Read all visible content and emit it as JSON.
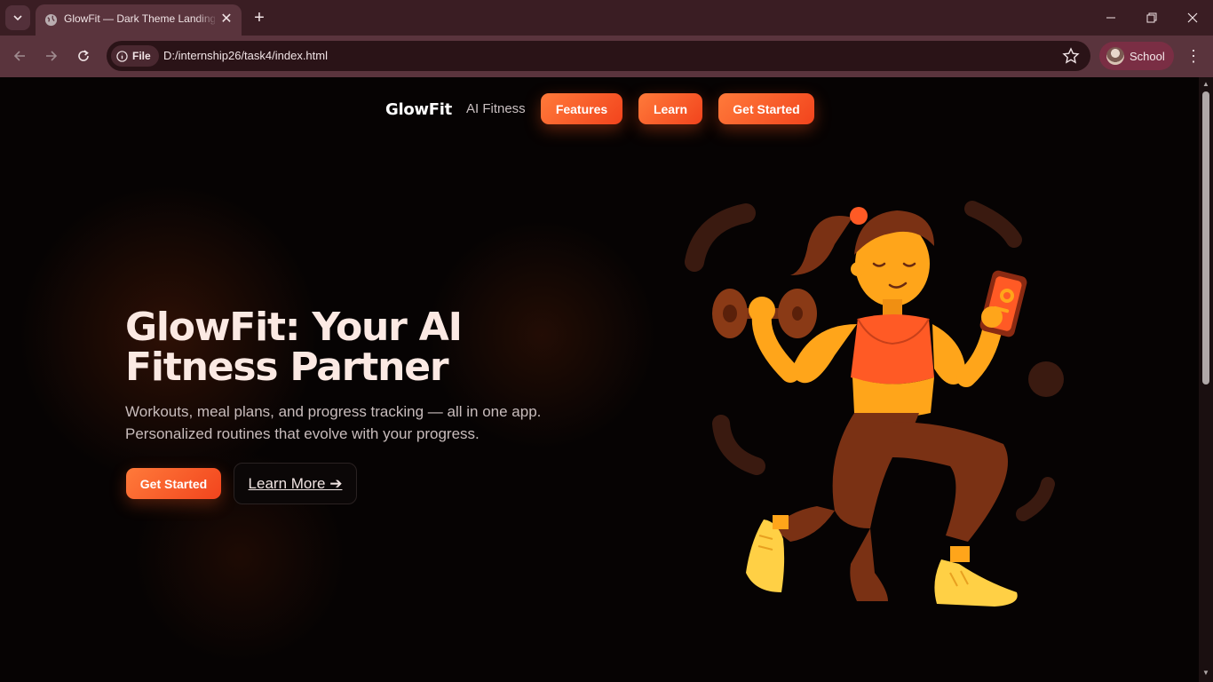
{
  "browser": {
    "tab_title": "GlowFit — Dark Theme Landing",
    "tab_close": "✕",
    "new_tab": "+",
    "url_chip": "File",
    "url": "D:/internship26/task4/index.html",
    "profile_name": "School",
    "menu_icon": "⋮"
  },
  "nav": {
    "brand": "GlowFit",
    "tagline": "AI Fitness",
    "links": [
      "Features",
      "Learn",
      "Get Started"
    ]
  },
  "hero": {
    "title": "GlowFit: Your AI Fitness Partner",
    "subtitle": "Workouts, meal plans, and progress tracking — all in one app. Personalized routines that evolve with your progress.",
    "cta_primary": "Get Started",
    "cta_secondary": "Learn More ➔"
  },
  "colors": {
    "accent": "#ff5a25",
    "background": "#060303",
    "chrome": "#5a343d"
  },
  "icons": [
    "tab-search-icon",
    "globe-icon",
    "back-arrow-icon",
    "forward-arrow-icon",
    "reload-icon",
    "info-icon",
    "star-icon",
    "minimize-icon",
    "restore-icon",
    "close-window-icon"
  ]
}
